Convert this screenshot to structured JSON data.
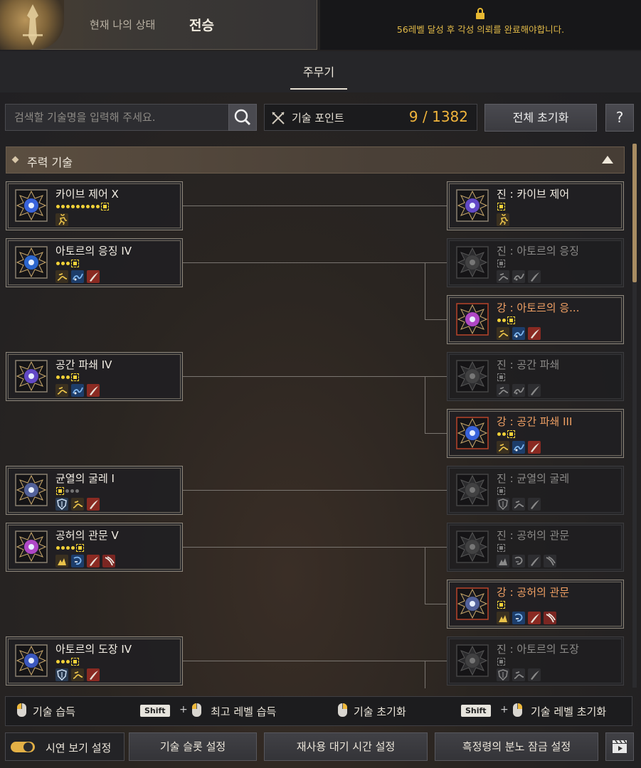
{
  "header": {
    "status_label": "현재 나의 상태",
    "class_name": "전승",
    "lock_message": "56레벨 달성 후 각성 의뢰를 완료해야합니다."
  },
  "tabs": [
    {
      "label": "주무기",
      "active": true
    }
  ],
  "search": {
    "placeholder": "검색할 기술명을 입력해 주세요."
  },
  "skill_points": {
    "label": "기술 포인트",
    "value": "9 / 1382"
  },
  "buttons": {
    "reset_all": "전체 초기화",
    "help": "?"
  },
  "category": {
    "label": "주력 기술"
  },
  "skills_left": [
    {
      "name": "카이브 제어 X",
      "dots": 9,
      "tags": [
        "run"
      ]
    },
    {
      "name": "아토르의 응징 IV",
      "dots": 3,
      "tags": [
        "kick",
        "wave",
        "slash"
      ]
    },
    {
      "name": "공간 파쇄 IV",
      "dots": 3,
      "tags": [
        "kick",
        "wave",
        "slash"
      ]
    },
    {
      "name": "균열의 굴레 I",
      "dots": 0,
      "off": 3,
      "tags": [
        "shield",
        "kick",
        "slash"
      ]
    },
    {
      "name": "공허의 관문 V",
      "dots": 4,
      "tags": [
        "down",
        "grab",
        "slash",
        "claw"
      ]
    },
    {
      "name": "아토르의 도장 IV",
      "dots": 3,
      "tags": [
        "shield",
        "kick",
        "slash"
      ]
    }
  ],
  "skills_right": [
    {
      "name": "진 : 카이브 제어",
      "state": "active",
      "tags": [
        "run"
      ]
    },
    {
      "name": "진 : 아토르의 응징",
      "state": "dim",
      "tags": [
        "kick",
        "wave",
        "slash"
      ]
    },
    {
      "name": "강 : 아토르의 응...",
      "state": "orange",
      "dots": 2,
      "tags": [
        "kick",
        "wave",
        "slash"
      ]
    },
    {
      "name": "진 : 공간 파쇄",
      "state": "dim",
      "tags": [
        "kick",
        "wave",
        "slash"
      ]
    },
    {
      "name": "강 : 공간 파쇄 III",
      "state": "orange",
      "dots": 2,
      "tags": [
        "kick",
        "wave",
        "slash"
      ]
    },
    {
      "name": "진 : 균열의 굴레",
      "state": "dim",
      "tags": [
        "shield",
        "kick",
        "slash"
      ]
    },
    {
      "name": "진 : 공허의 관문",
      "state": "dim",
      "tags": [
        "down",
        "grab",
        "slash",
        "claw"
      ]
    },
    {
      "name": "강 : 공허의 관문",
      "state": "orange",
      "dots": 0,
      "tags": [
        "down",
        "grab",
        "slash",
        "claw"
      ]
    },
    {
      "name": "진 : 아토르의 도장",
      "state": "dim",
      "tags": [
        "shield",
        "kick",
        "slash"
      ]
    }
  ],
  "legend": {
    "learn": "기술 습득",
    "shift_key": "Shift",
    "plus": "+",
    "max_learn": "최고 레벨 습득",
    "reset_skill": "기술 초기화",
    "reset_level": "기술 레벨 초기화"
  },
  "bottom_buttons": {
    "preview_toggle": "시연 보기 설정",
    "slot_setting": "기술 슬롯 설정",
    "cooldown_setting": "재사용 대기 시간 설정",
    "lock_setting": "흑정령의 분노 잠금 설정"
  },
  "colors": {
    "accent": "#f0b43c",
    "orange_text": "#f0a064",
    "lock": "#e0b948"
  }
}
